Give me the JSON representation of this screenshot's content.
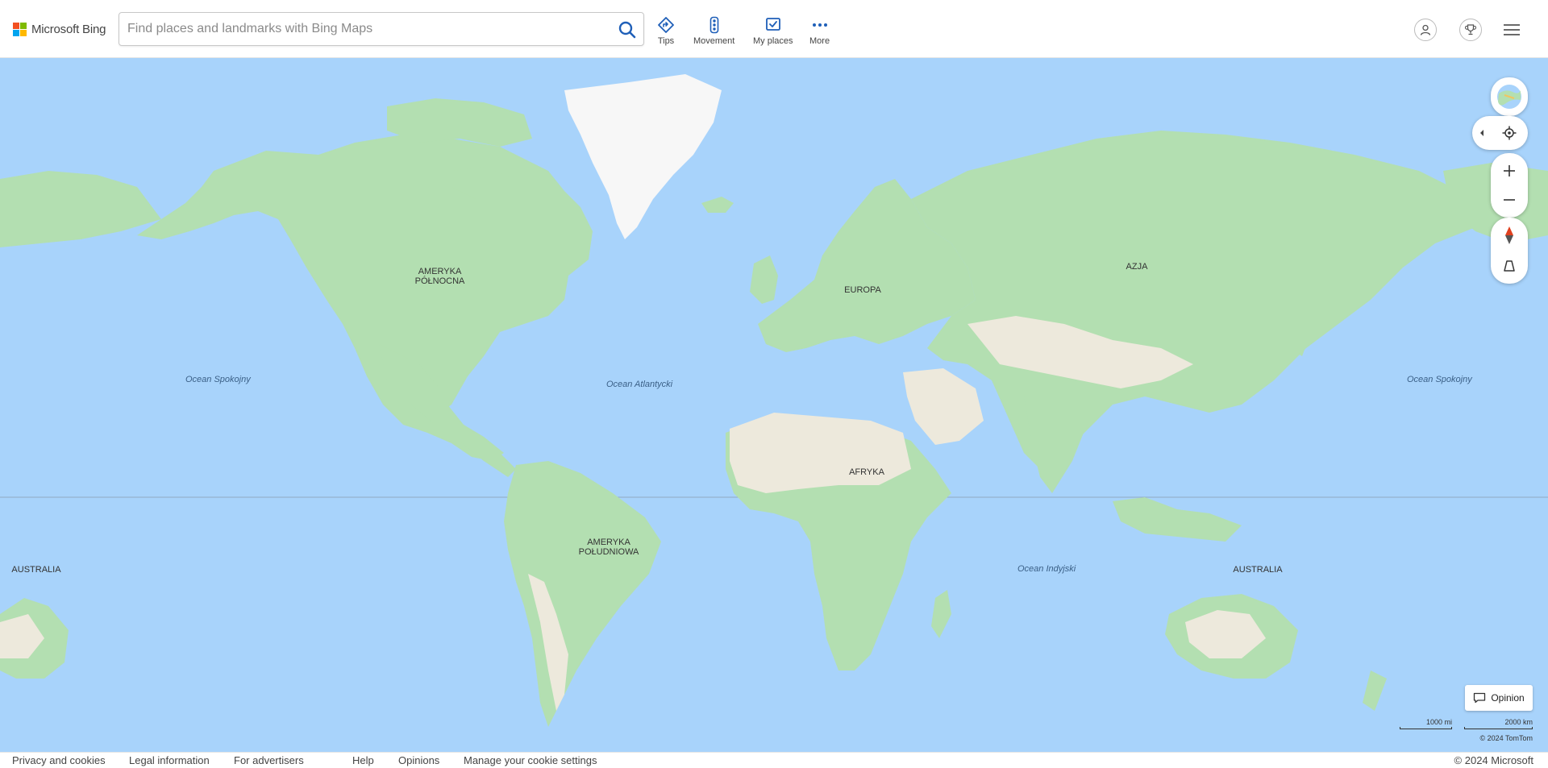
{
  "header": {
    "logo_text": "Microsoft Bing",
    "search_placeholder": "Find places and landmarks with Bing Maps",
    "nav": [
      {
        "label": "Tips"
      },
      {
        "label": "Movement"
      },
      {
        "label": "My places"
      },
      {
        "label": "More"
      }
    ]
  },
  "map": {
    "labels": {
      "north_america": "AMERYKA\nPÓŁNOCNA",
      "europe": "EUROPA",
      "asia": "AZJA",
      "africa": "AFRYKA",
      "south_america": "AMERYKA\nPOŁUDNIOWA",
      "australia_left": "AUSTRALIA",
      "australia_right": "AUSTRALIA"
    },
    "oceans": {
      "pacific_left": "Ocean Spokojny",
      "pacific_right": "Ocean Spokojny",
      "atlantic": "Ocean Atlantycki",
      "indian": "Ocean Indyjski"
    },
    "scale": {
      "imperial": "1000 mi",
      "metric": "2000 km"
    },
    "attribution": "© 2024 TomTom",
    "opinion_label": "Opinion",
    "colors": {
      "water": "#a8d3fb",
      "land_green": "#b3dfb1",
      "land_desert": "#ede9dc",
      "ice": "#f7f7f7"
    }
  },
  "footer": {
    "links": [
      "Privacy and cookies",
      "Legal information",
      "For advertisers",
      "Help",
      "Opinions",
      "Manage your cookie settings"
    ],
    "copyright": "© 2024 Microsoft"
  }
}
